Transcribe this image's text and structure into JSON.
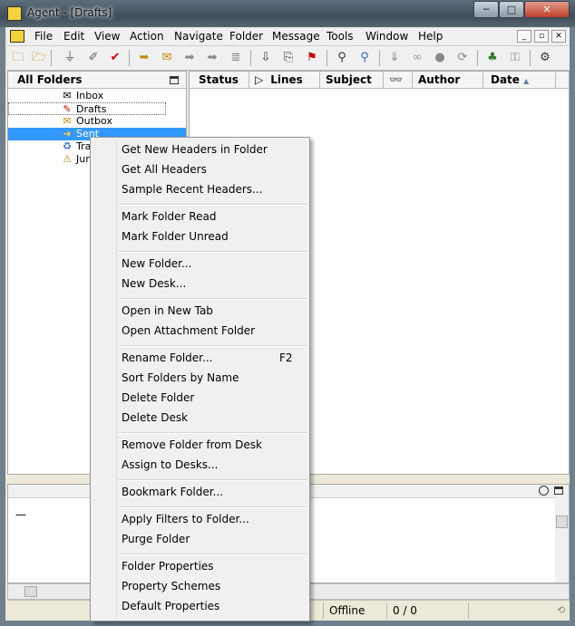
{
  "window": {
    "title": "Agent - [Drafts]",
    "minimize_glyph": "─",
    "maximize_glyph": "□",
    "close_glyph": "✕"
  },
  "menubar": {
    "items": [
      "File",
      "Edit",
      "View",
      "Action",
      "Navigate",
      "Folder",
      "Message",
      "Tools",
      "Window",
      "Help"
    ],
    "mdi_controls": [
      "_",
      "▫",
      "✕"
    ]
  },
  "toolbar": {
    "icons": [
      "folder-open-icon",
      "folder-stack-icon",
      "filter-icon",
      "post-icon",
      "check-mail-icon",
      "send-icon",
      "envelope-icon",
      "forward-icon",
      "reply-icon",
      "stack-icon",
      "download-icon",
      "attach-icon",
      "flag-icon",
      "search-icon",
      "advanced-search-icon",
      "down-arrow-icon",
      "link-icon",
      "purge-icon",
      "refresh-icon",
      "tree-icon",
      "network-icon",
      "settings-icon"
    ]
  },
  "folder_pane": {
    "header": "All Folders",
    "folders": [
      {
        "name": "Inbox",
        "icon": "inbox-icon",
        "glyph": "✉"
      },
      {
        "name": "Drafts",
        "icon": "drafts-icon",
        "glyph": "✎"
      },
      {
        "name": "Outbox",
        "icon": "outbox-icon",
        "glyph": "✉"
      },
      {
        "name": "Sent",
        "icon": "sent-icon",
        "glyph": "➜"
      },
      {
        "name": "Tra",
        "icon": "trash-icon",
        "glyph": "♻"
      },
      {
        "name": "Jun",
        "icon": "junk-icon",
        "glyph": "⚠"
      }
    ],
    "selected": "Sent"
  },
  "message_list": {
    "columns": [
      {
        "label": "Status"
      },
      {
        "label": "Lines",
        "icon_glyph": "▷"
      },
      {
        "label": "Subject"
      },
      {
        "label": "Author",
        "icon_glyph": "👓"
      },
      {
        "label": "Date",
        "sort_glyph": "▲"
      }
    ]
  },
  "bottom_pane": {
    "preview_text": "—"
  },
  "statusbar": {
    "mode": "Offline",
    "counts": "0 / 0"
  },
  "context_menu": {
    "groups": [
      [
        "Get New Headers in Folder",
        "Get All Headers",
        "Sample Recent Headers..."
      ],
      [
        "Mark Folder Read",
        "Mark Folder Unread"
      ],
      [
        "New Folder...",
        "New Desk..."
      ],
      [
        "Open in New Tab",
        "Open Attachment Folder"
      ],
      [
        "Rename Folder...",
        "Sort Folders by Name",
        "Delete Folder",
        "Delete Desk"
      ],
      [
        "Remove Folder from Desk",
        "Assign to Desks..."
      ],
      [
        "Bookmark Folder..."
      ],
      [
        "Apply Filters to Folder...",
        "Purge Folder"
      ],
      [
        "Folder Properties",
        "Property Schemes",
        "Default Properties"
      ]
    ],
    "shortcuts": {
      "Rename Folder...": "F2"
    }
  },
  "colors": {
    "selection": "#3399ff",
    "menu_bg": "#f0f0f0",
    "accent": "#3e4d59"
  }
}
